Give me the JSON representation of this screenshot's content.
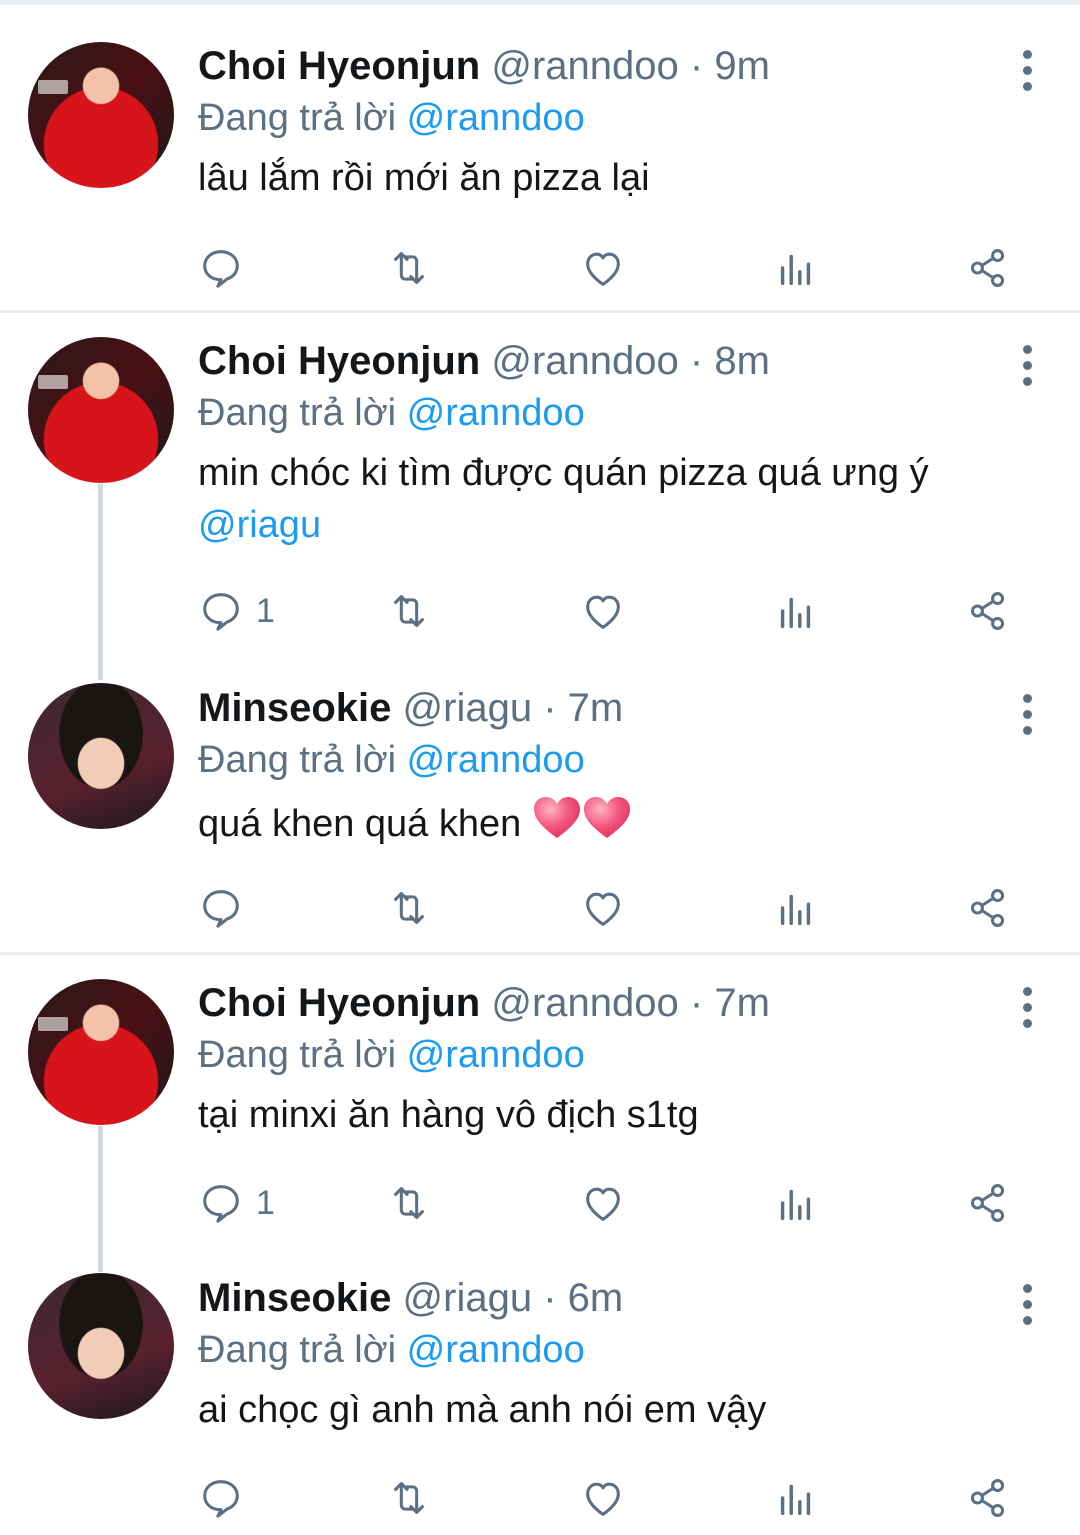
{
  "reply_prefix": "Đang trả lời",
  "tweets": [
    {
      "name": "Choi Hyeonjun",
      "handle": "@ranndoo",
      "dot": "·",
      "time": "9m",
      "reply_to": "@ranndoo",
      "text": "lâu lắm rồi mới ăn pizza lại",
      "reply_count": "",
      "avatar": "choi-avatar"
    },
    {
      "name": "Choi Hyeonjun",
      "handle": "@ranndoo",
      "dot": "·",
      "time": "8m",
      "reply_to": "@ranndoo",
      "text": "min chóc ki tìm được quán pizza quá ưng ý",
      "text_mention": "@riagu",
      "reply_count": "1",
      "avatar": "choi-avatar"
    },
    {
      "name": "Minseokie",
      "handle": "@riagu",
      "dot": "·",
      "time": "7m",
      "reply_to": "@ranndoo",
      "text": "quá khen quá khen",
      "emoji": "two-pink-hearts",
      "reply_count": "",
      "avatar": "minseokie-avatar"
    },
    {
      "name": "Choi Hyeonjun",
      "handle": "@ranndoo",
      "dot": "·",
      "time": "7m",
      "reply_to": "@ranndoo",
      "text": "tại minxi ăn hàng vô địch s1tg",
      "reply_count": "1",
      "avatar": "choi-avatar"
    },
    {
      "name": "Minseokie",
      "handle": "@riagu",
      "dot": "·",
      "time": "6m",
      "reply_to": "@ranndoo",
      "text": "ai chọc gì anh mà anh nói em vậy",
      "reply_count": "",
      "avatar": "minseokie-avatar"
    }
  ],
  "icons": [
    "reply-icon",
    "retweet-icon",
    "like-icon",
    "analytics-icon",
    "share-icon",
    "more-options-icon"
  ],
  "colors": {
    "link": "#1d9bf0",
    "secondary": "#5b7083",
    "divider": "#e6ecf0",
    "heart": "#f4577f"
  }
}
